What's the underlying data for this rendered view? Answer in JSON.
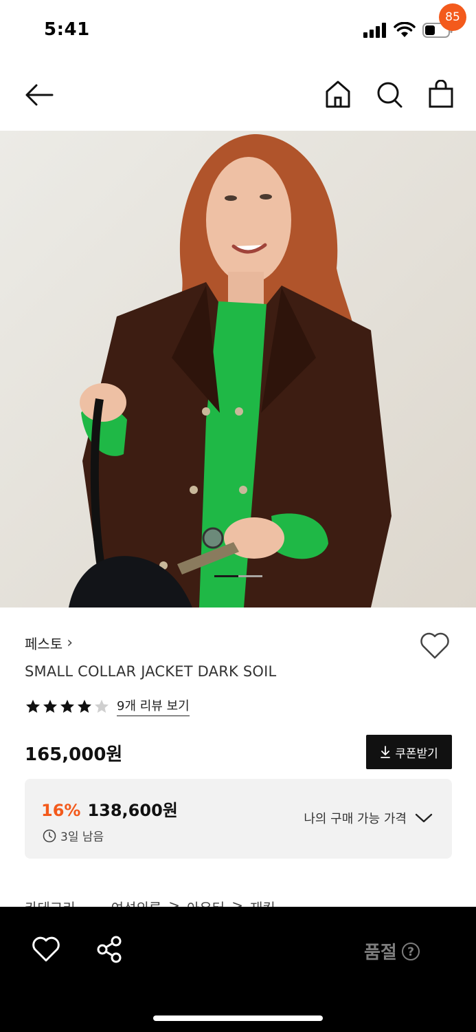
{
  "status_bar": {
    "time": "5:41",
    "icons": [
      "signal-icon",
      "wifi-icon",
      "battery-icon"
    ]
  },
  "nav": {
    "icons": [
      "back-arrow-icon",
      "home-icon",
      "search-icon",
      "shopping-bag-icon"
    ],
    "bag_badge": "85"
  },
  "hero": {
    "pager_total": 2,
    "pager_active": 1
  },
  "product": {
    "brand": "페스토",
    "brand_chevron": "›",
    "name": "SMALL COLLAR JACKET DARK SOIL",
    "rating_stars": 4,
    "rating_max": 5,
    "review_link": "9개 리뷰 보기",
    "price": "165,000원",
    "coupon_button": "쿠폰받기",
    "discount_rate": "16%",
    "discount_price": "138,600원",
    "remaining": "3일 남음",
    "my_price_label": "나의 구매 가능 가격"
  },
  "category": {
    "label": "카테고리",
    "path": [
      "여성의류",
      "아우터",
      "재킷"
    ],
    "separator": ">"
  },
  "bottom_bar": {
    "status": "품절",
    "help_icon": "?"
  },
  "colors": {
    "accent": "#f35a1c",
    "bottom_bar": "#000000",
    "price_box": "#f2f2f2"
  }
}
